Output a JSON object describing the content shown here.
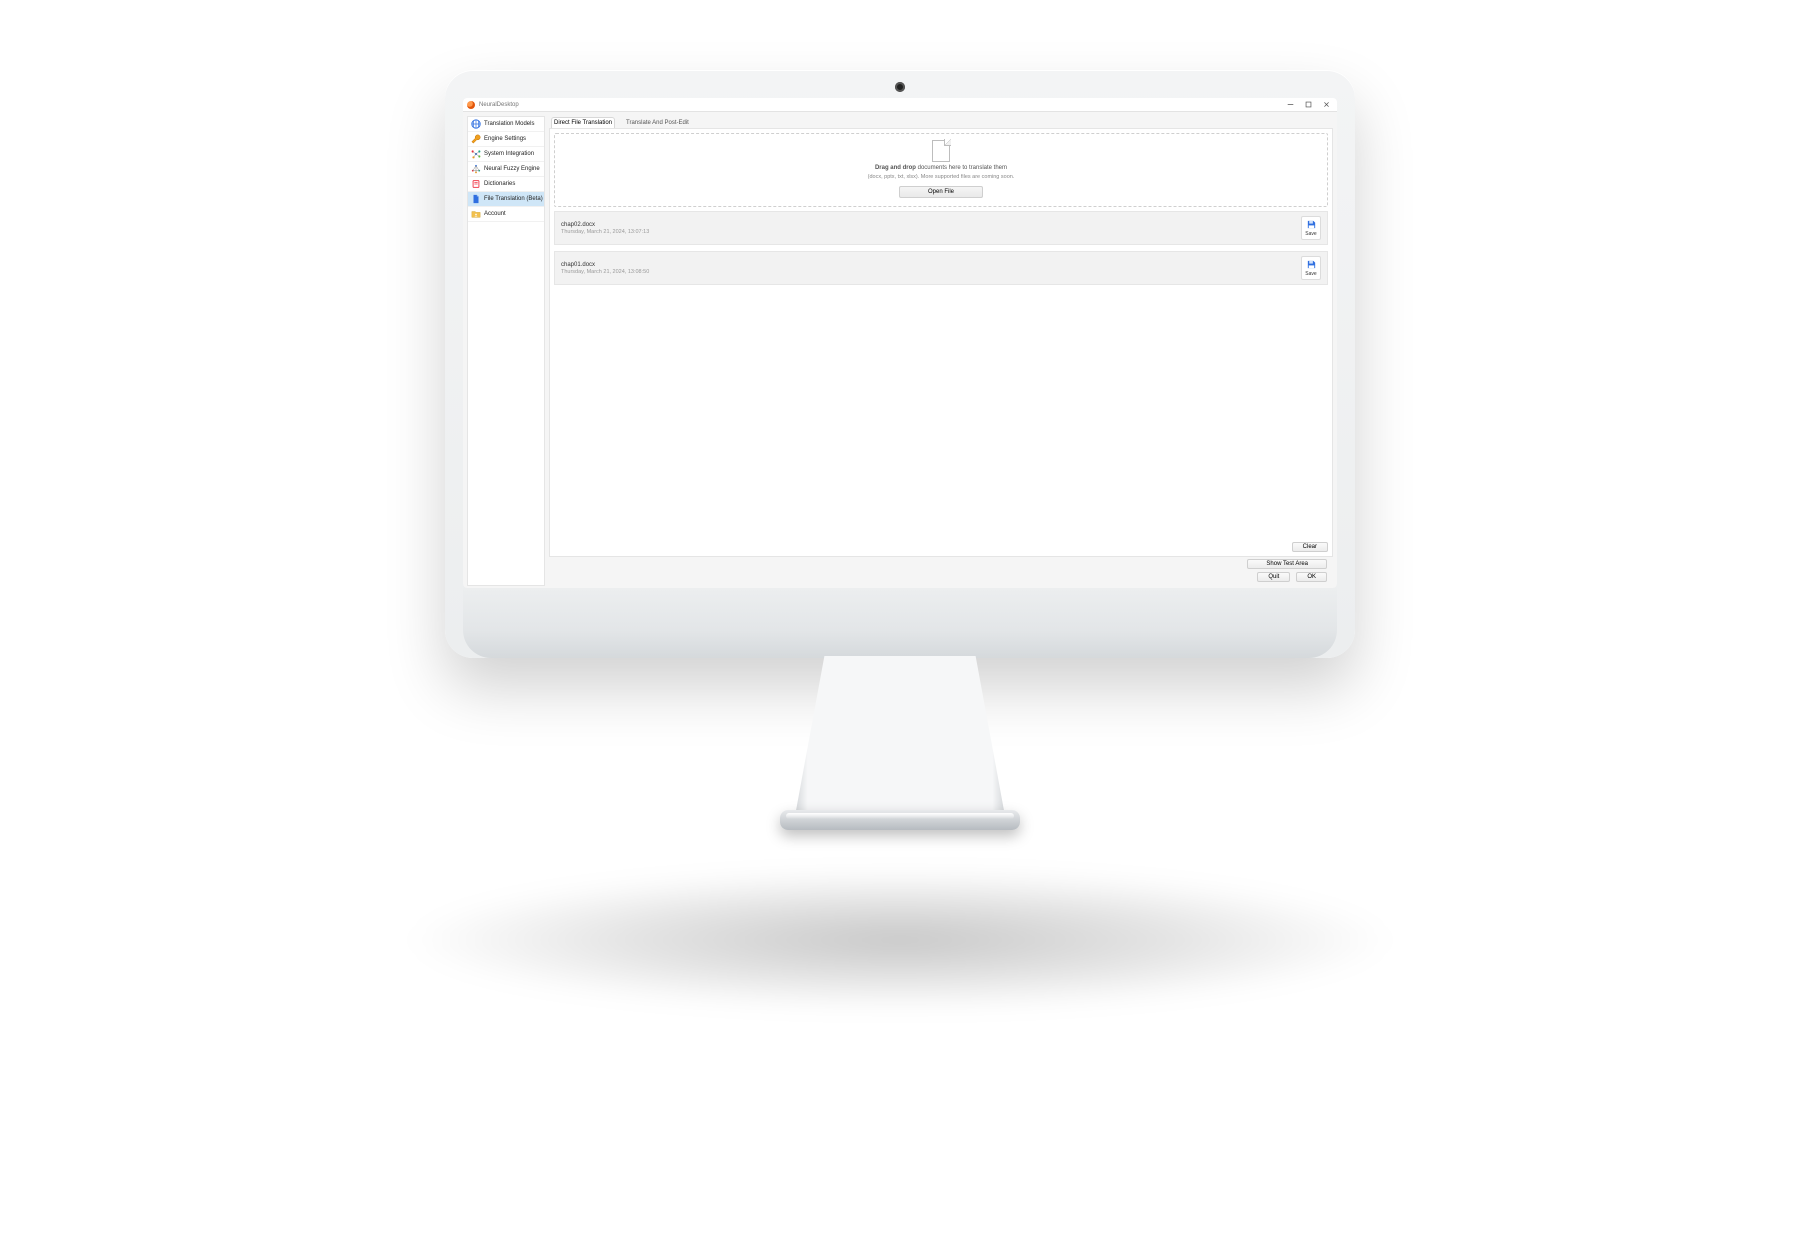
{
  "window": {
    "title": "NeuralDesktop",
    "controls": {
      "minimize": "–",
      "maximize": "▢",
      "close": "✕"
    }
  },
  "sidebar": {
    "items": [
      {
        "label": "Translation Models"
      },
      {
        "label": "Engine Settings"
      },
      {
        "label": "System Integration"
      },
      {
        "label": "Neural Fuzzy Engine"
      },
      {
        "label": "Dictionaries"
      },
      {
        "label": "File Translation (Beta)"
      },
      {
        "label": "Account"
      }
    ],
    "active_index": 5
  },
  "tabs": {
    "items": [
      {
        "label": "Direct File Translation"
      },
      {
        "label": "Translate And Post-Edit"
      }
    ],
    "active_index": 0
  },
  "dropzone": {
    "bold": "Drag and drop",
    "line1_rest": " documents here to translate them",
    "line2": "(docx, pptx, txt, xlsx). More supported files are coming soon.",
    "open_label": "Open File"
  },
  "files": [
    {
      "name": "chap02.docx",
      "date": "Thursday, March 21, 2024, 13:07:13",
      "save_label": "Save"
    },
    {
      "name": "chap01.docx",
      "date": "Thursday, March 21, 2024, 13:08:50",
      "save_label": "Save"
    }
  ],
  "buttons": {
    "clear": "Clear",
    "show_test_area": "Show Test Area",
    "quit": "Quit",
    "ok": "OK"
  },
  "colors": {
    "selection": "#cfe6f7",
    "save_icon": "#2f6fe0"
  }
}
